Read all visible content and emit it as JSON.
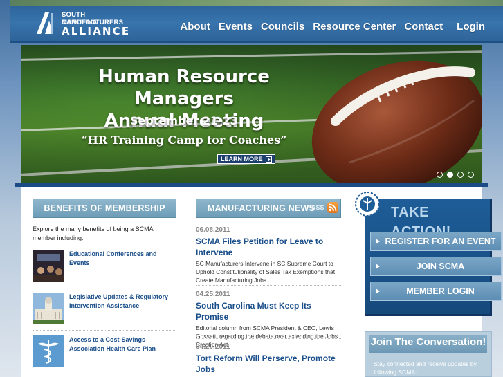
{
  "logo": {
    "line1": "SOUTH CAROLINA",
    "line2": "MANUFACTURERS",
    "line3": "ALLIANCE"
  },
  "nav": [
    "About",
    "Events",
    "Councils",
    "Resource Center",
    "Contact",
    "Login"
  ],
  "hero": {
    "title_line1": "Human Resource Managers",
    "title_line2": "Annual Meeting",
    "date": "September 21-23",
    "tagline": "“HR Training Camp for Coaches”",
    "learn_more": "LEARN MORE",
    "slide_count": 4,
    "active_slide": 2
  },
  "benefits": {
    "heading": "BENEFITS OF MEMBERSHIP",
    "intro": "Explore the many benefits of being a SCMA member including:",
    "items": [
      {
        "label": "Educational Conferences and Events",
        "icon": "conference-photo"
      },
      {
        "label": "Legislative Updates & Regulatory Intervention Assistance",
        "icon": "capitol-photo"
      },
      {
        "label": "Access to a Cost-Savings Association Health Care Plan",
        "icon": "caduceus-icon"
      }
    ]
  },
  "news": {
    "heading": "MANUFACTURING NEWS",
    "rss_label": "RSS",
    "items": [
      {
        "date": "06.08.2011",
        "title": "SCMA Files Petition for Leave to Intervene",
        "body": "SC Manufacturers Intervene in SC Supreme Court to Uphold Constitutionality of Sales Tax Exemptions that Create Manufacturing Jobs."
      },
      {
        "date": "04.25.2011",
        "title": "South Carolina Must Keep Its Promise",
        "body": "Editorial column from SCMA President & CEO, Lewis Gossett, regarding the debate over extending the Jobs Creation Act."
      },
      {
        "date": "04.20.2011",
        "title": "Tort Reform Will Perserve, Promote Jobs",
        "body": ""
      }
    ]
  },
  "take_action": {
    "title": "TAKE ACTION!",
    "buttons": [
      "REGISTER FOR AN EVENT",
      "JOIN SCMA",
      "MEMBER LOGIN"
    ]
  },
  "join": {
    "title": "Join The Conversation!",
    "text": "Stay connected and receive updates by following SCMA:"
  },
  "colors": {
    "header_blue": "#3874ad",
    "link_blue": "#1a4e8a",
    "section_head": "#7eaac3",
    "action_blue": "#1e5d98"
  }
}
